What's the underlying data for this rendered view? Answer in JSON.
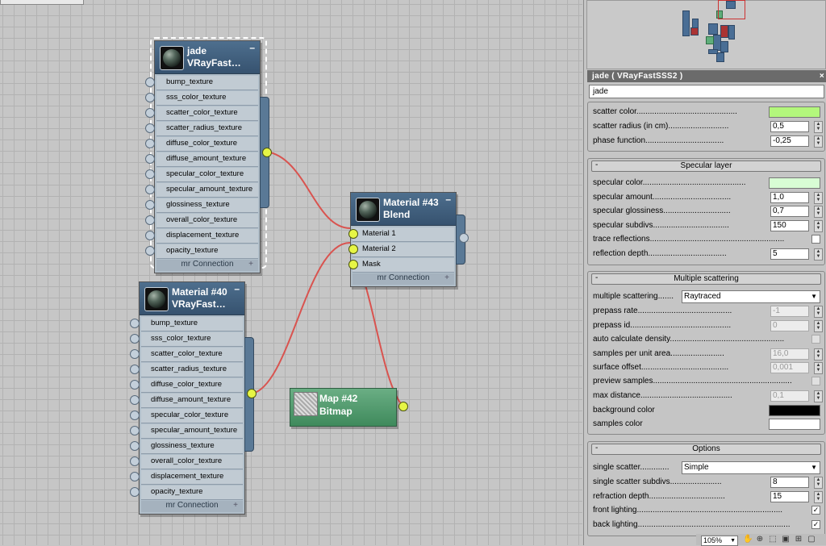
{
  "nodes": {
    "jade": {
      "title": "jade",
      "subtitle": "VRayFast…",
      "slots": [
        "bump_texture",
        "sss_color_texture",
        "scatter_color_texture",
        "scatter_radius_texture",
        "diffuse_color_texture",
        "diffuse_amount_texture",
        "specular_color_texture",
        "specular_amount_texture",
        "glossiness_texture",
        "overall_color_texture",
        "displacement_texture",
        "opacity_texture"
      ],
      "footer": "mr Connection"
    },
    "blend": {
      "title": "Material #43",
      "subtitle": "Blend",
      "slots": [
        "Material 1",
        "Material 2",
        "Mask"
      ],
      "footer": "mr Connection"
    },
    "mat40": {
      "title": "Material #40",
      "subtitle": "VRayFast…",
      "slots": [
        "bump_texture",
        "sss_color_texture",
        "scatter_color_texture",
        "scatter_radius_texture",
        "diffuse_color_texture",
        "diffuse_amount_texture",
        "specular_color_texture",
        "specular_amount_texture",
        "glossiness_texture",
        "overall_color_texture",
        "displacement_texture",
        "opacity_texture"
      ],
      "footer": "mr Connection"
    },
    "bitmap": {
      "title": "Map #42",
      "subtitle": "Bitmap"
    }
  },
  "panel": {
    "title": "jade ( VRayFastSSS2 )",
    "name_value": "jade",
    "scatter": {
      "scatter_color_label": "scatter color.............................................",
      "scatter_color": "#b3f77c",
      "scatter_radius_label": "scatter radius (in cm)...........................",
      "scatter_radius": "0,5",
      "phase_label": "phase function...................................",
      "phase": "-0,25"
    },
    "specular": {
      "header": "Specular layer",
      "color_label": "specular color..............................................",
      "color": "#d8fdd4",
      "amount_label": "specular amount...................................",
      "amount": "1,0",
      "gloss_label": "specular glossiness..............................",
      "gloss": "0,7",
      "subdivs_label": "specular subdivs..................................",
      "subdivs": "150",
      "trace_label": "trace reflections............................................................",
      "depth_label": "reflection depth...................................",
      "depth": "5"
    },
    "multiple": {
      "header": "Multiple scattering",
      "mode_label": "multiple scattering.......",
      "mode": "Raytraced",
      "prepass_rate_label": "prepass rate..........................................",
      "prepass_rate": "-1",
      "prepass_id_label": "prepass id.............................................",
      "prepass_id": "0",
      "auto_density_label": "auto calculate density...................................................",
      "samples_area_label": "samples per unit area........................",
      "samples_area": "16,0",
      "surface_offset_label": "surface offset.......................................",
      "surface_offset": "0,001",
      "preview_label": "preview samples..............................................................",
      "max_dist_label": "max distance.........................................",
      "max_dist": "0,1",
      "bg_color_label": "background color",
      "bg_color": "#000000",
      "samples_color_label": "samples color",
      "samples_color": "#ffffff"
    },
    "options": {
      "header": "Options",
      "single_label": "single scatter.............",
      "single": "Simple",
      "single_subdivs_label": "single scatter subdivs.......................",
      "single_subdivs": "8",
      "refr_depth_label": "refraction depth..................................",
      "refr_depth": "15",
      "front_label": "front lighting.................................................................",
      "back_label": "back lighting...................................................................."
    }
  },
  "status": {
    "zoom": "105%"
  },
  "icons": [
    "pan-hand-icon",
    "zoom-icon",
    "zoom-region-icon",
    "frame-selected-icon",
    "frame-all-icon",
    "viewport-icon"
  ],
  "colors": {
    "wire": "#d9534f",
    "socket_active": "#e6f545",
    "node_blue": "#4e6f8e",
    "node_green": "#3f8a5c"
  }
}
